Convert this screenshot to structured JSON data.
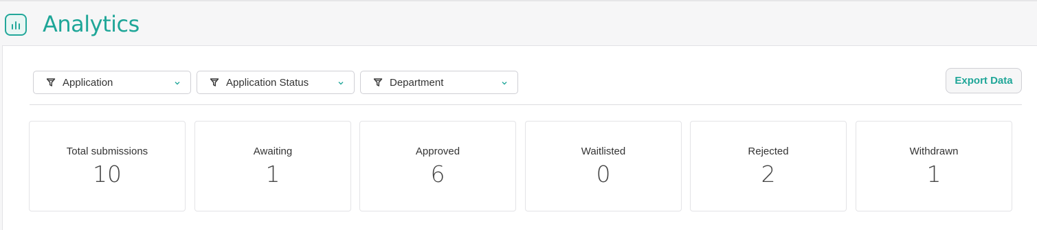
{
  "header": {
    "title": "Analytics",
    "icon": "bar-chart-icon"
  },
  "filters": [
    {
      "label": "Application",
      "icon": "funnel-icon"
    },
    {
      "label": "Application Status",
      "icon": "funnel-icon"
    },
    {
      "label": "Department",
      "icon": "funnel-icon"
    }
  ],
  "toolbar": {
    "export_label": "Export Data"
  },
  "stats": [
    {
      "label": "Total submissions",
      "value": "10"
    },
    {
      "label": "Awaiting",
      "value": "1"
    },
    {
      "label": "Approved",
      "value": "6"
    },
    {
      "label": "Waitlisted",
      "value": "0"
    },
    {
      "label": "Rejected",
      "value": "2"
    },
    {
      "label": "Withdrawn",
      "value": "1"
    }
  ],
  "colors": {
    "accent": "#1fa698",
    "border": "#cfcfd4",
    "background": "#f6f6f7"
  }
}
